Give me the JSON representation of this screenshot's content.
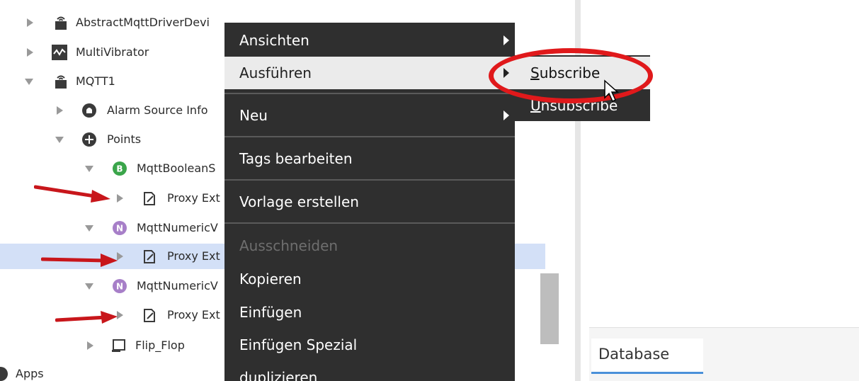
{
  "tree": {
    "items": [
      {
        "label": "AbstractMqttDriverDevi",
        "icon": "device-icon",
        "expander": "right"
      },
      {
        "label": "MultiVibrator",
        "icon": "wave-icon",
        "expander": "right"
      },
      {
        "label": "MQTT1",
        "icon": "device-icon",
        "expander": "down"
      },
      {
        "label": "Alarm Source Info",
        "icon": "alarm-icon",
        "expander": "right"
      },
      {
        "label": "Points",
        "icon": "points-icon",
        "expander": "down"
      },
      {
        "label": "MqttBooleanS",
        "icon": "boolean-point-icon",
        "badge": "B",
        "expander": "down"
      },
      {
        "label": "Proxy Ext",
        "icon": "proxy-ext-icon",
        "expander": "right"
      },
      {
        "label": "MqttNumericV",
        "icon": "numeric-point-icon",
        "badge": "N",
        "expander": "down"
      },
      {
        "label": "Proxy Ext",
        "icon": "proxy-ext-icon",
        "expander": "right"
      },
      {
        "label": "MqttNumericV",
        "icon": "numeric-point-icon",
        "badge": "N",
        "expander": "down"
      },
      {
        "label": "Proxy Ext",
        "icon": "proxy-ext-icon",
        "expander": "right"
      },
      {
        "label": "Flip_Flop",
        "icon": "component-icon",
        "expander": "right"
      },
      {
        "label": "Apps",
        "icon": "apps-icon",
        "expander": "none"
      }
    ]
  },
  "context_menu": {
    "items": [
      {
        "label": "Ansichten",
        "has_submenu": true
      },
      {
        "label": "Ausführen",
        "has_submenu": true,
        "highlighted": true
      },
      {
        "label": "Neu",
        "has_submenu": true
      },
      {
        "label": "Tags bearbeiten"
      },
      {
        "label": "Vorlage erstellen"
      },
      {
        "label": "Ausschneiden",
        "disabled": true
      },
      {
        "label": "Kopieren"
      },
      {
        "label": "Einfügen"
      },
      {
        "label": "Einfügen Spezial"
      },
      {
        "label": "duplizieren"
      }
    ]
  },
  "submenu": {
    "items": [
      {
        "first": "S",
        "rest": "ubscribe",
        "highlighted": true
      },
      {
        "first": "U",
        "rest": "nsubscribe"
      }
    ]
  },
  "right_panel": {
    "tab": "Database"
  },
  "colors": {
    "menu_bg": "#2f2f2f",
    "highlight_bg": "#ebebeb",
    "selection_bg": "#d3e0f7",
    "annotation_red": "#e0191b",
    "tab_accent": "#4a90d9"
  }
}
